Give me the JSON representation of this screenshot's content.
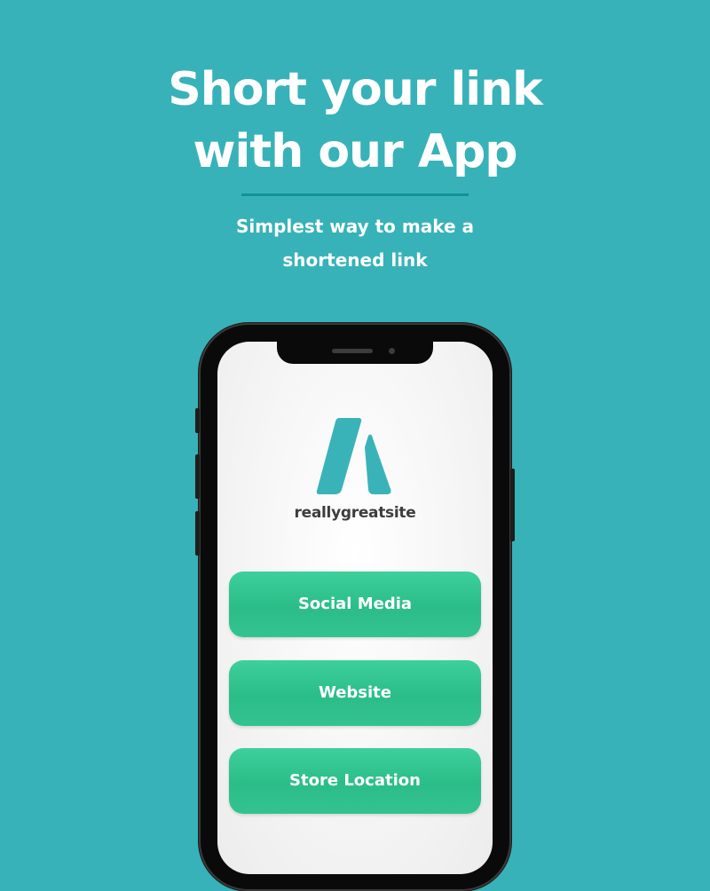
{
  "header": {
    "title_line1": "Short your link",
    "title_line2": "with our App",
    "subtitle_line1": "Simplest way to make a",
    "subtitle_line2": "shortened link"
  },
  "app": {
    "brand_name": "reallygreatsite",
    "logo_icon": "a-shape-logo-icon",
    "buttons": [
      {
        "label": "Social Media"
      },
      {
        "label": "Website"
      },
      {
        "label": "Store Location"
      }
    ]
  },
  "colors": {
    "background": "#37b2b8",
    "divider": "#11919a",
    "button_green": "#2fc08c",
    "logo": "#3ab3b8",
    "brand_text": "#3d3d3d"
  }
}
